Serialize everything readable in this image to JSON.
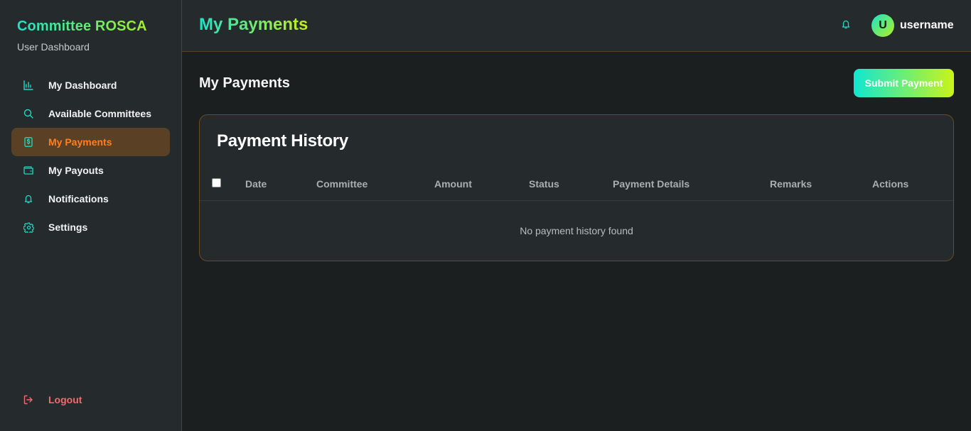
{
  "brand": {
    "title": "Committee ROSCA",
    "subtitle": "User Dashboard"
  },
  "sidebar": {
    "items": [
      {
        "label": "My Dashboard",
        "icon": "bar-chart-icon",
        "active": false
      },
      {
        "label": "Available Committees",
        "icon": "search-icon",
        "active": false
      },
      {
        "label": "My Payments",
        "icon": "dollar-receipt-icon",
        "active": true
      },
      {
        "label": "My Payouts",
        "icon": "wallet-icon",
        "active": false
      },
      {
        "label": "Notifications",
        "icon": "bell-icon",
        "active": false
      },
      {
        "label": "Settings",
        "icon": "gear-icon",
        "active": false
      }
    ],
    "logout": "Logout"
  },
  "header": {
    "title": "My Payments",
    "user": {
      "initial": "U",
      "name": "username"
    }
  },
  "main": {
    "heading": "My Payments",
    "submit_label": "Submit Payment",
    "card": {
      "title": "Payment History",
      "columns": [
        "Date",
        "Committee",
        "Amount",
        "Status",
        "Payment Details",
        "Remarks",
        "Actions"
      ],
      "empty_message": "No payment history found",
      "select_all_checked": false
    }
  },
  "colors": {
    "accent_teal": "#1fe2c8",
    "accent_lime": "#c4ef1a",
    "active_orange": "#ff7f1f",
    "logout_red": "#f26a6a",
    "background": "#1b1f20",
    "panel": "#252b2d"
  }
}
